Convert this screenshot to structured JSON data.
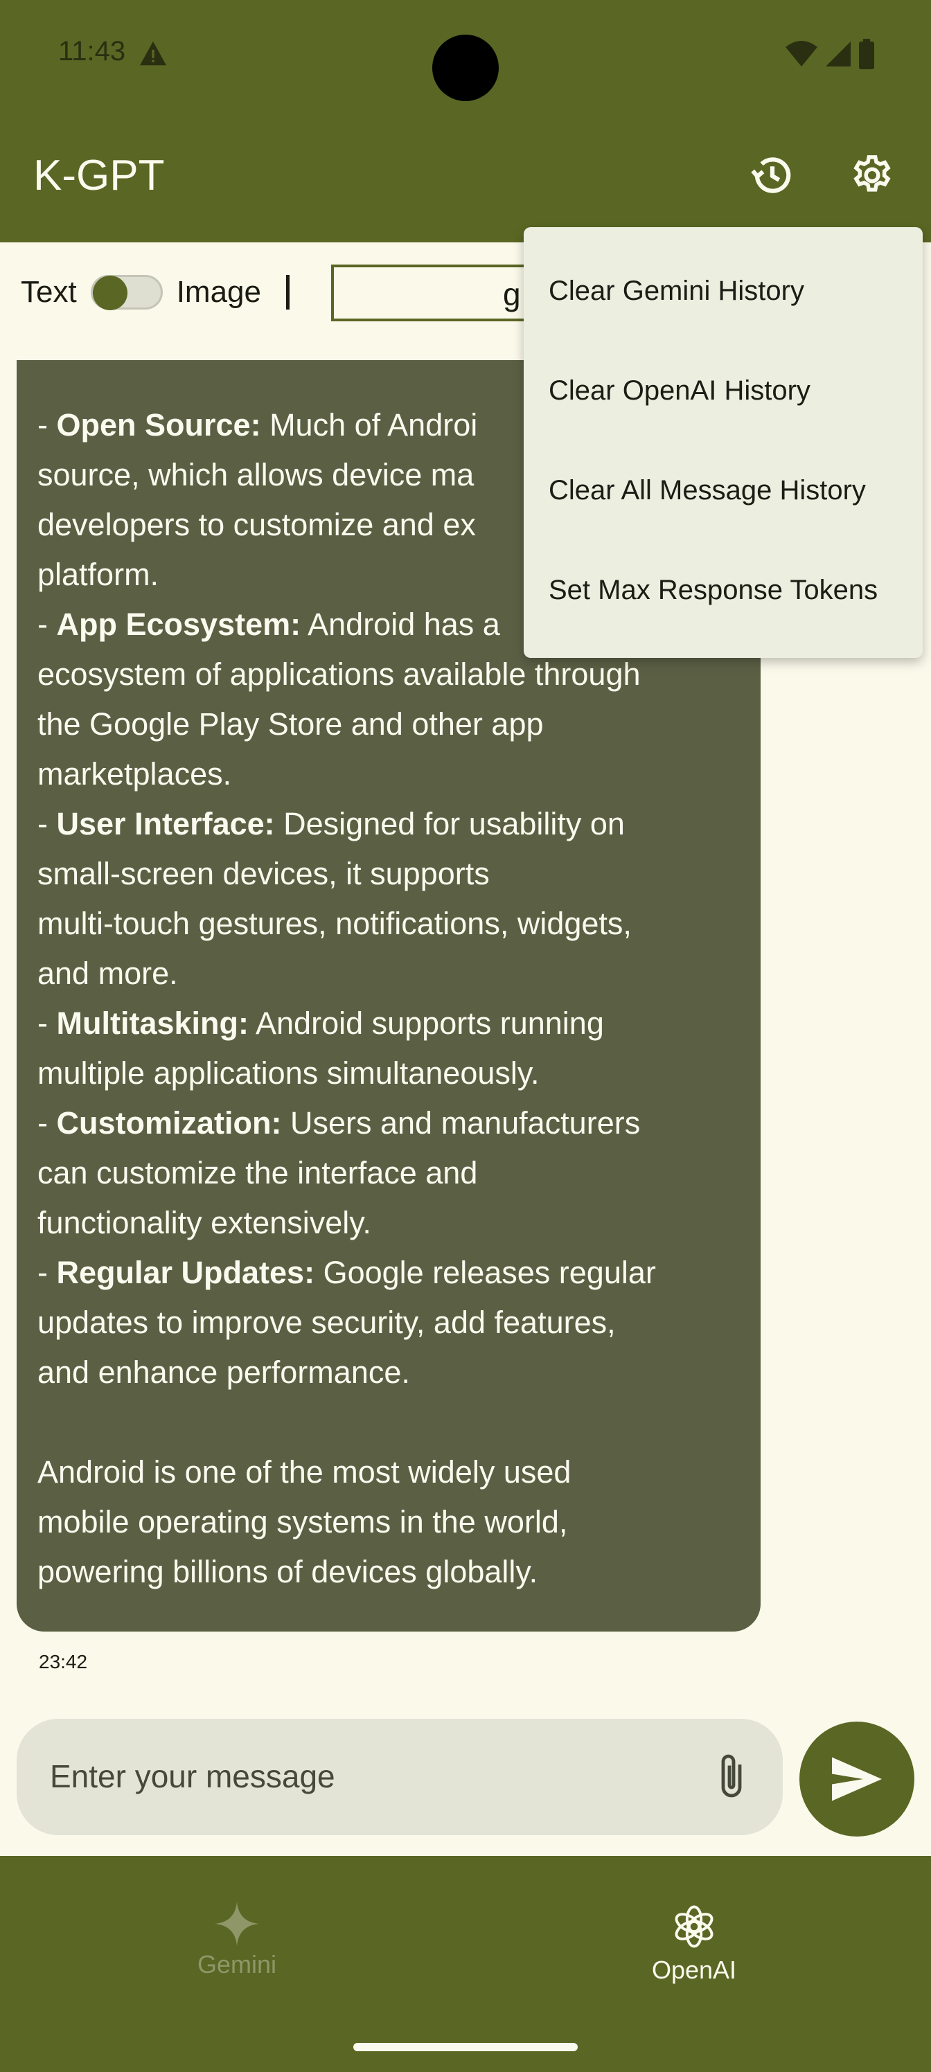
{
  "status_bar": {
    "time": "11:43"
  },
  "app_bar": {
    "title": "K-GPT"
  },
  "mode_toggle": {
    "text_label": "Text",
    "image_label": "Image",
    "model_value": "g"
  },
  "message": {
    "paragraphs": [
      {
        "bold": "Open Source:",
        "lines": [
          "Much of Androi",
          "source, which allows device ma",
          "developers to customize and ex",
          "platform."
        ]
      },
      {
        "bold": "App Ecosystem:",
        "lines": [
          "Android has a",
          "ecosystem of applications available through",
          "the Google Play Store and other app",
          "marketplaces."
        ]
      },
      {
        "bold": "User Interface:",
        "lines": [
          "Designed for usability on",
          "small-screen devices, it supports",
          "multi-touch gestures, notifications, widgets,",
          "and more."
        ]
      },
      {
        "bold": "Multitasking:",
        "lines": [
          "Android supports running",
          "multiple applications simultaneously."
        ]
      },
      {
        "bold": "Customization:",
        "lines": [
          "Users and manufacturers",
          "can customize the interface and",
          "functionality extensively."
        ]
      },
      {
        "bold": "Regular Updates:",
        "lines": [
          "Google releases regular",
          "updates to improve security, add features,",
          "and enhance performance."
        ]
      }
    ],
    "closing_lines": [
      "Android is one of the most widely used",
      "mobile operating systems in the world,",
      "powering billions of devices globally."
    ],
    "timestamp": "23:42"
  },
  "input": {
    "placeholder": "Enter your message"
  },
  "menu": {
    "items": [
      "Clear Gemini History",
      "Clear OpenAI History",
      "Clear All Message History",
      "Set Max Response Tokens"
    ]
  },
  "bottom_nav": {
    "items": [
      {
        "label": "Gemini",
        "icon": "sparkle-icon",
        "selected": false
      },
      {
        "label": "OpenAI",
        "icon": "openai-icon",
        "selected": true
      }
    ]
  },
  "colors": {
    "primary": "#5a6623",
    "background": "#fbf9ea",
    "bubble": "#5b6045",
    "menu": "#eceee0",
    "input": "#e3e3d6"
  }
}
